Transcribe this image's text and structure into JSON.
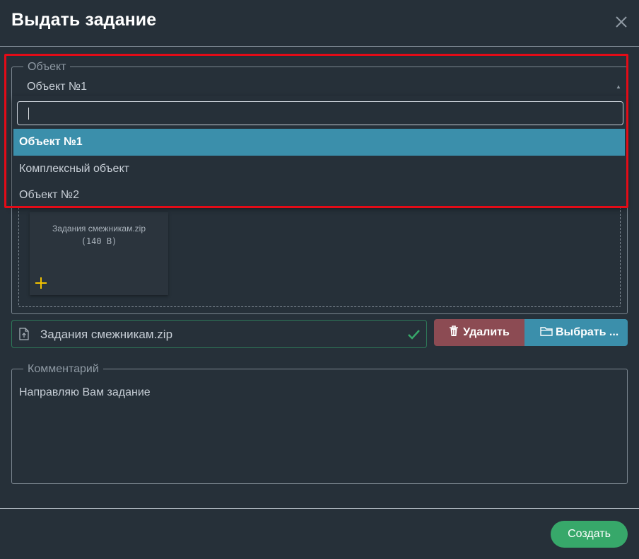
{
  "modal": {
    "title": "Выдать задание",
    "close_icon": "close-icon"
  },
  "object_field": {
    "legend": "Объект",
    "selected_value": "Объект №1",
    "search_value": "",
    "options": [
      {
        "label": "Объект №1",
        "active": true
      },
      {
        "label": "Комплексный объект",
        "active": false
      },
      {
        "label": "Объект №2",
        "active": false
      }
    ]
  },
  "attachment": {
    "card_name": "Задания смежникам.zip",
    "card_size": "(140 B)",
    "add_icon": "plus-icon",
    "file_name": "Задания смежникам.zip",
    "file_icon": "file-upload-icon",
    "status_icon": "check-icon",
    "delete_label": "Удалить",
    "delete_icon": "trash-icon",
    "select_label": "Выбрать ...",
    "select_icon": "folder-icon"
  },
  "comment": {
    "legend": "Комментарий",
    "value": "Направляю Вам задание"
  },
  "footer": {
    "create_label": "Создать"
  },
  "colors": {
    "background": "#263039",
    "accent_blue": "#3b8fab",
    "danger": "#8c4b53",
    "success": "#37a86a",
    "highlight_outline": "#e30b17",
    "check": "#37a86a",
    "plus": "#f2c200"
  }
}
